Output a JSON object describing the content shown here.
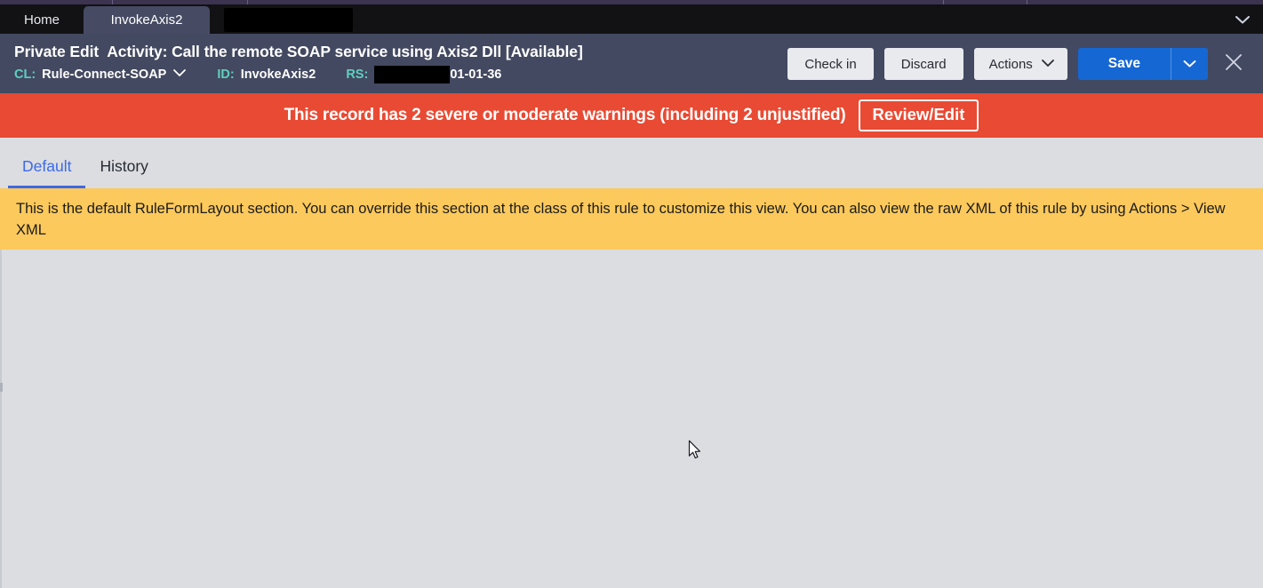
{
  "browser": {
    "tabstrip_color": "#3c3350"
  },
  "tabbar": {
    "tabs": [
      {
        "label": "Home",
        "active": false
      },
      {
        "label": "InvokeAxis2",
        "active": true
      }
    ],
    "redacted_tab_label": "",
    "overflow_icon": "chevron-down-icon"
  },
  "header": {
    "mode": "Private Edit",
    "title": "Activity: Call the remote SOAP service using Axis2 Dll",
    "status": "[Available]",
    "meta": [
      {
        "key": "CL:",
        "value": "Rule-Connect-SOAP",
        "has_dropdown": true
      },
      {
        "key": "ID:",
        "value": "InvokeAxis2",
        "has_dropdown": false
      },
      {
        "key": "RS:",
        "value": "01-01-36",
        "has_dropdown": false,
        "redacted": true
      }
    ],
    "buttons": {
      "check_in": "Check in",
      "discard": "Discard",
      "actions": "Actions",
      "save": "Save"
    },
    "close_icon": "close-icon",
    "accent": "#1567d3",
    "bg": "#434960",
    "key_color": "#5fd0c0"
  },
  "warning": {
    "message": "This record has 2 severe or moderate warnings (including 2 unjustified)",
    "button": "Review/Edit",
    "bg": "#e84a33"
  },
  "subtabs": {
    "items": [
      {
        "label": "Default",
        "active": true
      },
      {
        "label": "History",
        "active": false
      }
    ],
    "active_color": "#3b69e8"
  },
  "notice": {
    "text": "This is the default RuleFormLayout section. You can override this section at the class of this rule to customize this view. You can also view the raw XML of this rule by using Actions > View XML",
    "bg": "#fcc95c"
  },
  "body": {
    "bg": "#dcdde1"
  }
}
